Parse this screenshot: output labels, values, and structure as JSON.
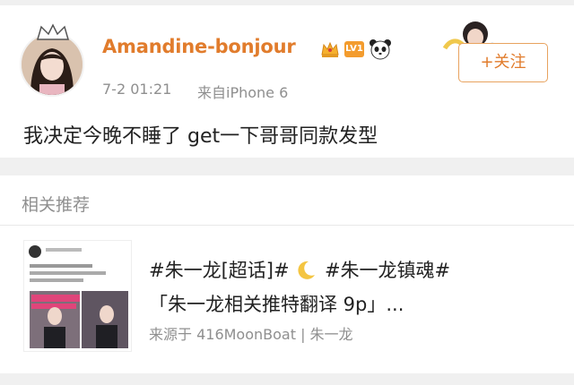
{
  "post": {
    "username": "Amandine-bonjour",
    "level_badge": "LV1",
    "timestamp": "7-2 01:21",
    "source": "来自iPhone 6",
    "follow_label": "+关注",
    "content": "我决定今晚不睡了 get一下哥哥同款发型"
  },
  "related": {
    "section_title": "相关推荐",
    "item": {
      "tags_part1": "#朱一龙[超话]#",
      "tags_part2": "#朱一龙镇魂#",
      "title": "「朱一龙相关推特翻译 9p」...",
      "source": "来源于 416MoonBoat | 朱一龙"
    }
  },
  "icons": {
    "crown": "crown-icon",
    "panda": "panda-icon",
    "moon": "moon-icon"
  },
  "colors": {
    "username": "#e17c2c",
    "follow_border": "#e8a35f",
    "meta_text": "#8f8f8f",
    "background": "#f0f0f0"
  }
}
